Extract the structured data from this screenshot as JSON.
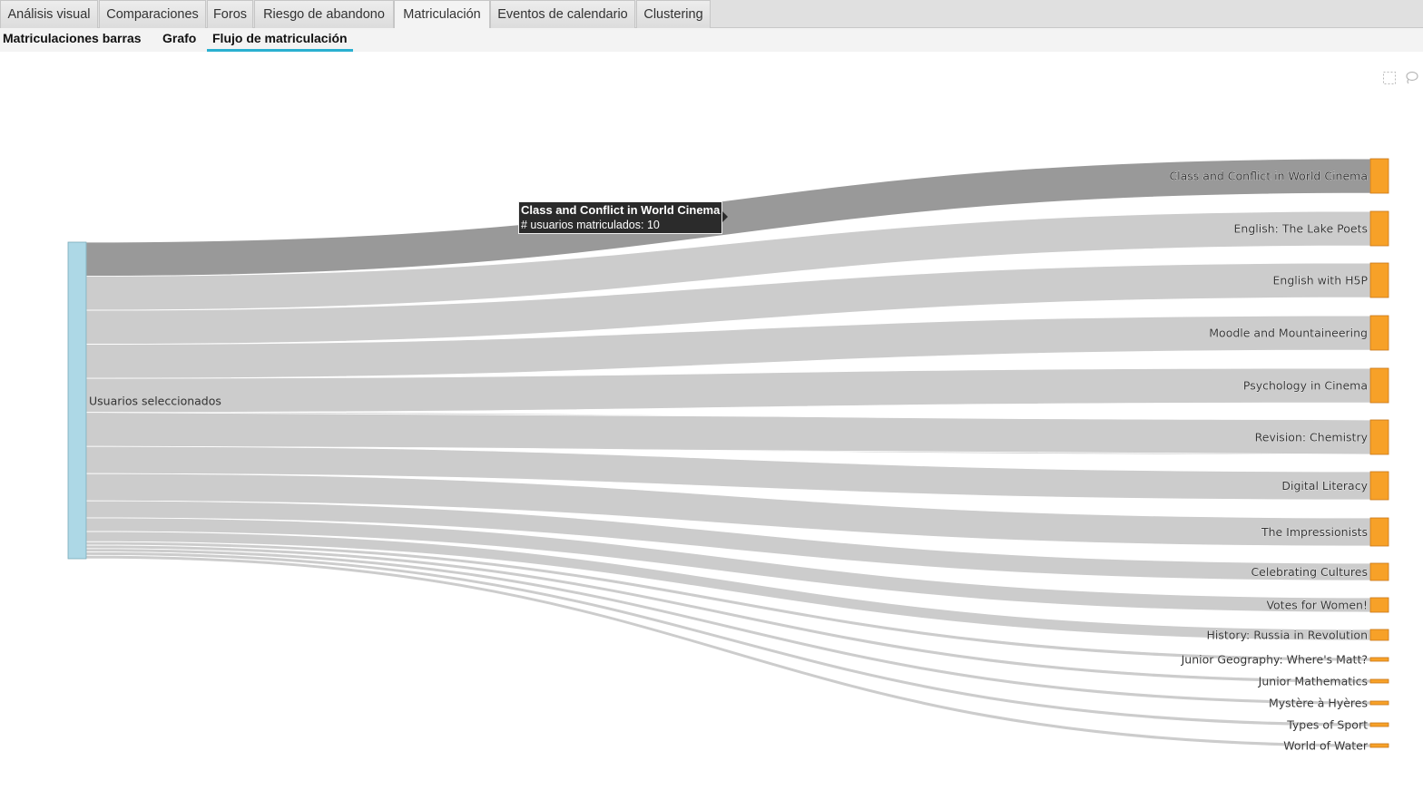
{
  "tabs": [
    {
      "label": "Análisis visual",
      "active": false
    },
    {
      "label": "Comparaciones",
      "active": false
    },
    {
      "label": "Foros",
      "active": false
    },
    {
      "label": "Riesgo de abandono",
      "active": false
    },
    {
      "label": "Matriculación",
      "active": true
    },
    {
      "label": "Eventos de calendario",
      "active": false
    },
    {
      "label": "Clustering",
      "active": false
    }
  ],
  "subtabs": [
    {
      "label": "Matriculaciones barras",
      "active": false
    },
    {
      "label": "Grafo",
      "active": false
    },
    {
      "label": "Flujo de matriculación",
      "active": true
    }
  ],
  "toolbar_icons": [
    "box-select-icon",
    "lasso-select-icon"
  ],
  "tooltip": {
    "title": "Class and Conflict in World Cinema",
    "text": "# usuarios matriculados: 10"
  },
  "chart_data": {
    "type": "sankey",
    "source": {
      "label": "Usuarios seleccionados",
      "color": "#add8e6"
    },
    "target_color": "#f7a128",
    "link_color": "#cccccc",
    "highlight_color": "#999999",
    "targets": [
      {
        "label": "Class and Conflict in World Cinema",
        "value": 10,
        "highlighted": true
      },
      {
        "label": "English: The Lake Poets",
        "value": 10
      },
      {
        "label": "English with H5P",
        "value": 10
      },
      {
        "label": "Moodle and Mountaineering",
        "value": 10
      },
      {
        "label": "Psychology in Cinema",
        "value": 10
      },
      {
        "label": "Revision: Chemistry",
        "value": 10
      },
      {
        "label": "Digital Literacy",
        "value": 8
      },
      {
        "label": "The Impressionists",
        "value": 8
      },
      {
        "label": "Celebrating Cultures",
        "value": 5
      },
      {
        "label": "Votes for Women!",
        "value": 4
      },
      {
        "label": "History: Russia in Revolution",
        "value": 3
      },
      {
        "label": "Junior Geography: Where's Matt?",
        "value": 1
      },
      {
        "label": "Junior Mathematics",
        "value": 1
      },
      {
        "label": "Mystère à Hyères",
        "value": 1
      },
      {
        "label": "Types of Sport",
        "value": 1
      },
      {
        "label": "World of Water",
        "value": 1
      }
    ]
  }
}
